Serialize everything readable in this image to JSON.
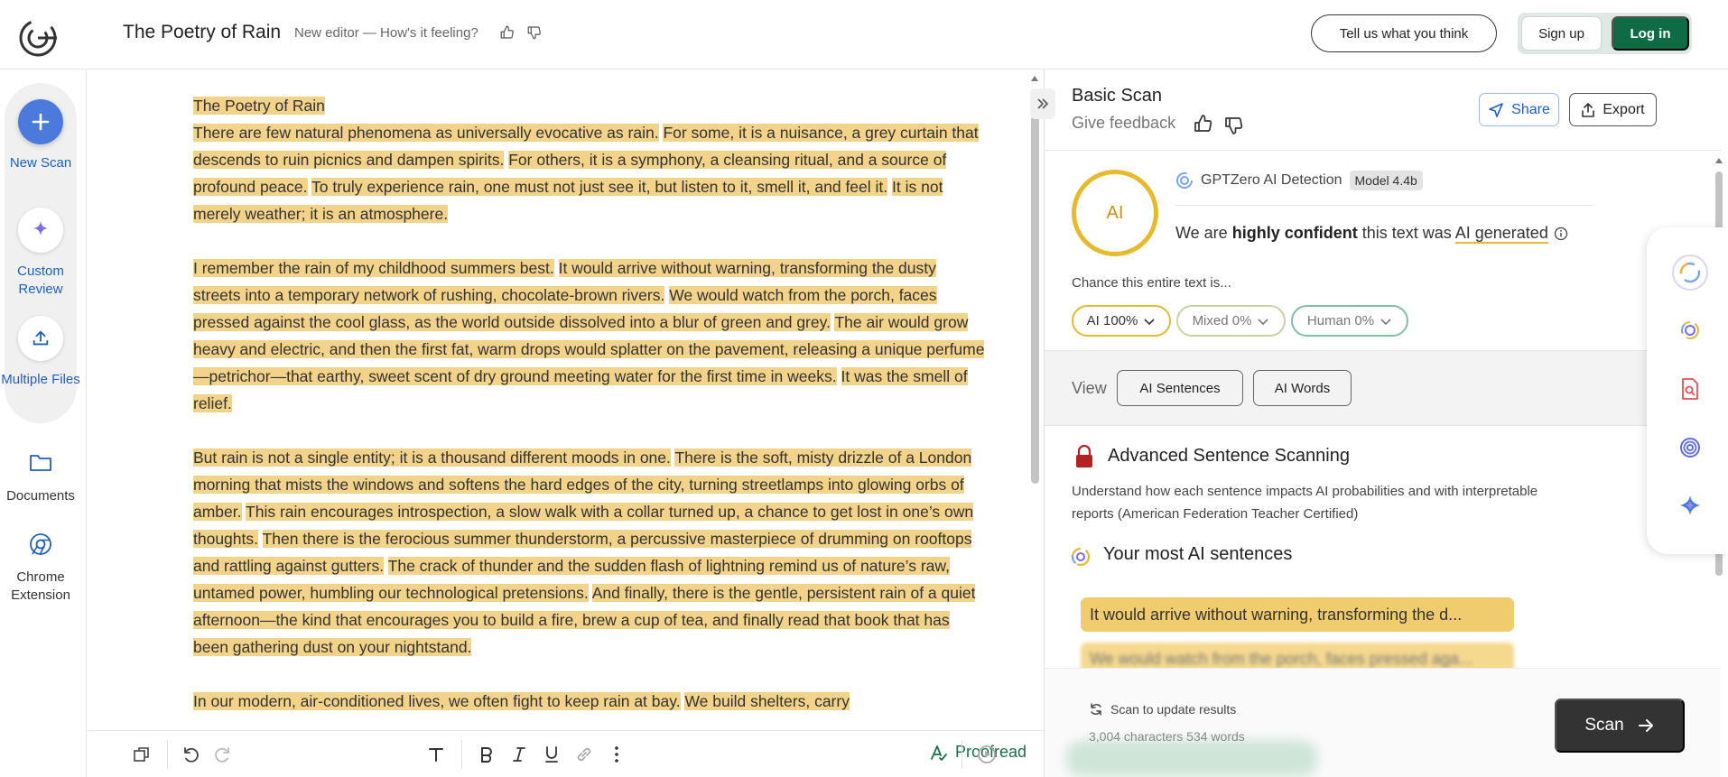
{
  "header": {
    "doc_title": "The Poetry of Rain",
    "editor_note": "New editor — How's it feeling?",
    "feedback_button": "Tell us what you think",
    "signup": "Sign up",
    "login": "Log in"
  },
  "sidebar": {
    "new_scan": "New Scan",
    "custom_review": "Custom Review",
    "multiple_files": "Multiple Files",
    "documents": "Documents",
    "chrome_extension": "Chrome Extension"
  },
  "editor": {
    "title": "The Poetry of Rain",
    "paragraphs": [
      [
        {
          "t": "There are few natural phenomena as universally evocative as rain.",
          "h": true
        },
        {
          "t": " ",
          "h": false
        },
        {
          "t": "For some, it is a nuisance, a grey curtain that descends to ruin picnics and dampen spirits.",
          "h": true
        },
        {
          "t": " ",
          "h": false
        },
        {
          "t": "For others, it is a symphony, a cleansing ritual, and a source of profound peace.",
          "h": true
        },
        {
          "t": " ",
          "h": false
        },
        {
          "t": "To truly experience rain, one must not just see it, but listen to it, smell it, and feel it.",
          "h": true
        },
        {
          "t": " ",
          "h": false
        },
        {
          "t": "It is not merely weather; it is an atmosphere.",
          "h": true
        }
      ],
      [
        {
          "t": "I remember the rain of my childhood summers best.",
          "h": true
        },
        {
          "t": " ",
          "h": false
        },
        {
          "t": "It would arrive without warning, transforming the dusty streets into a temporary network of rushing, chocolate-brown rivers.",
          "h": true
        },
        {
          "t": " ",
          "h": false
        },
        {
          "t": "We would watch from the porch, faces pressed against the cool glass, as the world outside dissolved into a blur of green and grey.",
          "h": true
        },
        {
          "t": " ",
          "h": false
        },
        {
          "t": "The air would grow heavy and electric, and then the first fat, warm drops would splatter on the pavement, releasing a unique perfume—petrichor—that earthy, sweet scent of dry ground meeting water for the first time in weeks.",
          "h": true
        },
        {
          "t": " ",
          "h": false
        },
        {
          "t": "It was the smell of relief.",
          "h": true
        }
      ],
      [
        {
          "t": "But rain is not a single entity; it is a thousand different moods in one.",
          "h": true
        },
        {
          "t": " ",
          "h": false
        },
        {
          "t": "There is the soft, misty drizzle of a London morning that mists the windows and softens the hard edges of the city, turning streetlamps into glowing orbs of amber.",
          "h": true
        },
        {
          "t": " ",
          "h": false
        },
        {
          "t": "This rain encourages introspection, a slow walk with a collar turned up, a chance to get lost in one’s own thoughts.",
          "h": true
        },
        {
          "t": " ",
          "h": false
        },
        {
          "t": "Then there is the ferocious summer thunderstorm, a percussive masterpiece of drumming on rooftops and rattling against gutters.",
          "h": true
        },
        {
          "t": " ",
          "h": false
        },
        {
          "t": "The crack of thunder and the sudden flash of lightning remind us of nature’s raw, untamed power, humbling our technological pretensions.",
          "h": true
        },
        {
          "t": " ",
          "h": false
        },
        {
          "t": "And finally, there is the gentle, persistent rain of a quiet afternoon—the kind that encourages you to build a fire, brew a cup of tea, and finally read that book that has been gathering dust on your nightstand.",
          "h": true
        }
      ],
      [
        {
          "t": "In our modern, air-conditioned lives, we often fight to keep rain at bay.",
          "h": true
        },
        {
          "t": " ",
          "h": false
        },
        {
          "t": "We build shelters, carry",
          "h": true
        }
      ]
    ]
  },
  "toolbar": {
    "proofread": "Proofread"
  },
  "panel": {
    "title": "Basic Scan",
    "give_feedback": "Give feedback",
    "share": "Share",
    "export": "Export",
    "ai_circle_label": "AI",
    "detector_name": "GPTZero AI Detection",
    "model_badge": "Model 4.4b",
    "confidence_prefix": "We are ",
    "confidence_strong": "highly confident",
    "confidence_mid": " this text was ",
    "confidence_result": "AI generated",
    "chance_text": "Chance this entire text is...",
    "pills": {
      "ai": "AI 100%",
      "mixed": "Mixed 0%",
      "human": "Human 0%"
    },
    "view_label": "View",
    "view_buttons": {
      "sentences": "AI Sentences",
      "words": "AI Words"
    },
    "advanced_title": "Advanced Sentence Scanning",
    "advanced_desc": "Understand how each sentence impacts AI probabilities and with interpretable reports (American Federation Teacher Certified)",
    "most_ai_title": "Your most AI sentences",
    "top_sentence": "It would arrive without warning, transforming the d...",
    "blurred_sentence": "We would watch from the porch, faces pressed aga...",
    "scan_update": "Scan to update results",
    "scan_counts": "3,004 characters 534 words",
    "scan_button": "Scan"
  },
  "colors": {
    "highlight": "#f2d389",
    "ai_yellow": "#e7b92e",
    "brand_green": "#0f6b43",
    "link_blue": "#1f5fbf"
  }
}
